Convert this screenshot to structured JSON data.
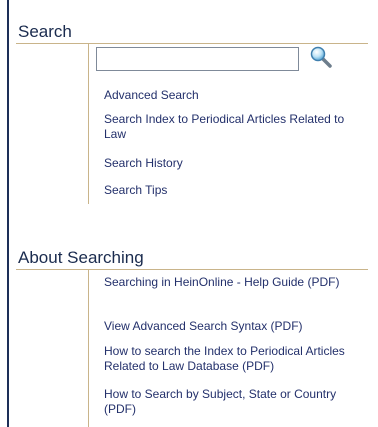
{
  "search_section": {
    "title": "Search",
    "input": {
      "value": "",
      "placeholder": ""
    },
    "search_button_icon": "magnifier-icon",
    "links": [
      "Advanced Search",
      "Search Index to Periodical Articles Related to Law",
      "Search History",
      "Search Tips"
    ]
  },
  "about_section": {
    "title": "About Searching",
    "links": [
      "Searching in HeinOnline - Help Guide (PDF)",
      "View Advanced Search Syntax (PDF)",
      "How to search the Index to Periodical Articles Related to Law Database (PDF)",
      "How to Search by Subject, State or Country (PDF)"
    ]
  },
  "colors": {
    "heading": "#1a2b4e",
    "link": "#23306b",
    "rule": "#c9b48a",
    "left_border": "#1d2f58"
  }
}
